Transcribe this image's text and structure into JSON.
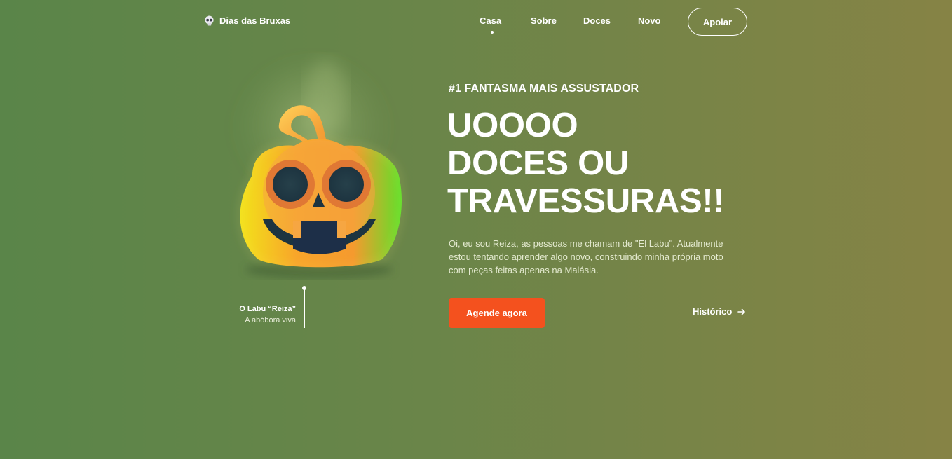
{
  "header": {
    "logo_text": "Dias das Bruxas",
    "logo_icon": "skull-icon",
    "nav": [
      {
        "label": "Casa",
        "active": true
      },
      {
        "label": "Sobre"
      },
      {
        "label": "Doces"
      },
      {
        "label": "Novo"
      }
    ],
    "support_label": "Apoiar"
  },
  "hero": {
    "eyebrow": "#1 FANTASMA MAIS ASSUSTADOR",
    "headline": [
      "UOOOO",
      "DOCES OU",
      "TRAVESSURAS!!"
    ],
    "intro": "Oi, eu sou Reiza, as pessoas me chamam de \"El Labu\". Atualmente estou tentando aprender algo novo, construindo minha própria moto com peças feitas apenas na Malásia.",
    "cta_label": "Agende agora",
    "history_label": "Histórico",
    "history_icon": "arrow-right-icon"
  },
  "character": {
    "name": "O Labu “Reiza”",
    "subtitle": "A abóbora viva",
    "illustration": "pumpkin-icon"
  },
  "colors": {
    "cta": "#f4511e",
    "bg_left": "#5a8549",
    "bg_right": "#868345"
  }
}
